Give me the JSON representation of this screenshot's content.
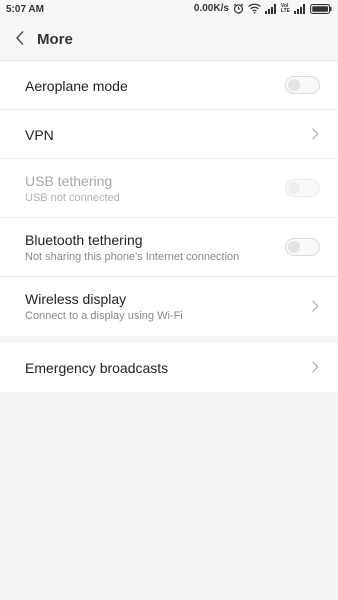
{
  "status_bar": {
    "time": "5:07 AM",
    "speed": "0.00K/s",
    "volte_top": "VoI",
    "volte_bottom": "LTE"
  },
  "header": {
    "title": "More"
  },
  "settings": {
    "aeroplane_mode": {
      "title": "Aeroplane mode",
      "toggle_on": false
    },
    "vpn": {
      "title": "VPN"
    },
    "usb_tethering": {
      "title": "USB tethering",
      "subtitle": "USB not connected",
      "enabled": false,
      "toggle_on": false
    },
    "bluetooth_tethering": {
      "title": "Bluetooth tethering",
      "subtitle": "Not sharing this phone's Internet connection",
      "toggle_on": false
    },
    "wireless_display": {
      "title": "Wireless display",
      "subtitle": "Connect to a display using Wi-Fi"
    },
    "emergency_broadcasts": {
      "title": "Emergency broadcasts"
    }
  },
  "icons": {
    "back": "chevron-left-icon",
    "alarm": "alarm-clock-icon",
    "wifi": "wifi-icon",
    "signal": "cellular-signal-icon",
    "battery": "battery-icon",
    "row_arrow": "chevron-right-icon"
  },
  "colors": {
    "background": "#f5f5f5",
    "card": "#ffffff",
    "text_primary": "#222222",
    "text_secondary": "#8a8a8a",
    "text_disabled": "#a8a8a8"
  }
}
